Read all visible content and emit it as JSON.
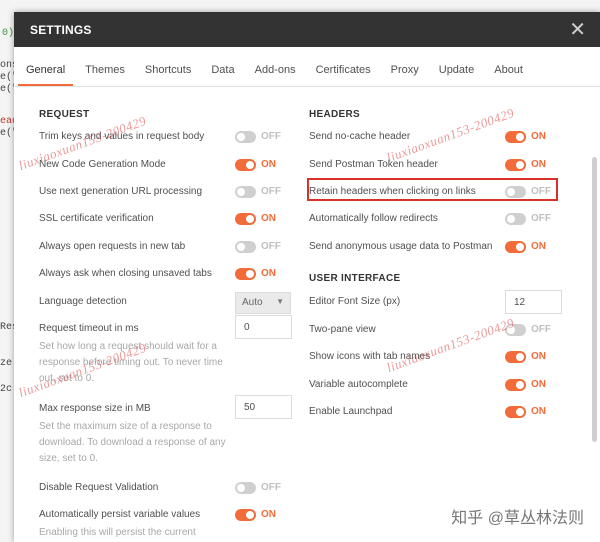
{
  "background": {
    "fragments": [
      "0)",
      "ons",
      "e(\"",
      "e(\"",
      "ead",
      "e(\"",
      "Res",
      "ze",
      "2c"
    ]
  },
  "modal": {
    "title": "SETTINGS",
    "close_glyph": "✕"
  },
  "tabs": [
    {
      "label": "General",
      "active": true
    },
    {
      "label": "Themes",
      "active": false
    },
    {
      "label": "Shortcuts",
      "active": false
    },
    {
      "label": "Data",
      "active": false
    },
    {
      "label": "Add-ons",
      "active": false
    },
    {
      "label": "Certificates",
      "active": false
    },
    {
      "label": "Proxy",
      "active": false
    },
    {
      "label": "Update",
      "active": false
    },
    {
      "label": "About",
      "active": false
    }
  ],
  "request": {
    "title": "REQUEST",
    "trim_keys": {
      "label": "Trim keys and values in request body",
      "state": "OFF",
      "on": false
    },
    "new_codegen": {
      "label": "New Code Generation Mode",
      "state": "ON",
      "on": true
    },
    "next_gen_url": {
      "label": "Use next generation URL processing",
      "state": "OFF",
      "on": false
    },
    "ssl_verify": {
      "label": "SSL certificate verification",
      "state": "ON",
      "on": true
    },
    "open_new_tab": {
      "label": "Always open requests in new tab",
      "state": "OFF",
      "on": false
    },
    "ask_closing": {
      "label": "Always ask when closing unsaved tabs",
      "state": "ON",
      "on": true
    },
    "language_detection": {
      "label": "Language detection",
      "value": "Auto"
    },
    "request_timeout": {
      "label": "Request timeout in ms",
      "value": "0",
      "desc": "Set how long a request should wait for a response before timing out. To never time out, set to 0."
    },
    "max_response": {
      "label": "Max response size in MB",
      "value": "50",
      "desc": "Set the maximum size of a response to download. To download a response of any size, set to 0."
    },
    "disable_validation": {
      "label": "Disable Request Validation",
      "state": "OFF",
      "on": false
    },
    "persist_vars": {
      "label": "Automatically persist variable values",
      "state": "ON",
      "on": true,
      "desc": "Enabling this will persist the current"
    }
  },
  "headers": {
    "title": "HEADERS",
    "no_cache": {
      "label": "Send no-cache header",
      "state": "ON",
      "on": true
    },
    "postman_token": {
      "label": "Send Postman Token header",
      "state": "ON",
      "on": true
    },
    "retain_headers": {
      "label": "Retain headers when clicking on links",
      "state": "OFF",
      "on": false
    },
    "follow_redirects": {
      "label": "Automatically follow redirects",
      "state": "OFF",
      "on": false
    },
    "anon_usage": {
      "label": "Send anonymous usage data to Postman",
      "state": "ON",
      "on": true
    }
  },
  "ui": {
    "title": "USER INTERFACE",
    "editor_font": {
      "label": "Editor Font Size (px)",
      "value": "12"
    },
    "two_pane": {
      "label": "Two-pane view",
      "state": "OFF",
      "on": false
    },
    "show_icons": {
      "label": "Show icons with tab names",
      "state": "ON",
      "on": true
    },
    "var_autocomplete": {
      "label": "Variable autocomplete",
      "state": "ON",
      "on": true
    },
    "launchpad": {
      "label": "Enable Launchpad",
      "state": "ON",
      "on": true
    }
  },
  "watermark": {
    "text": "liuxiaoxuan153-200429",
    "logo": "知乎 @草丛林法则"
  },
  "colors": {
    "accent": "#f26b3a",
    "header_bg": "#333333",
    "highlight": "#d9302c"
  }
}
